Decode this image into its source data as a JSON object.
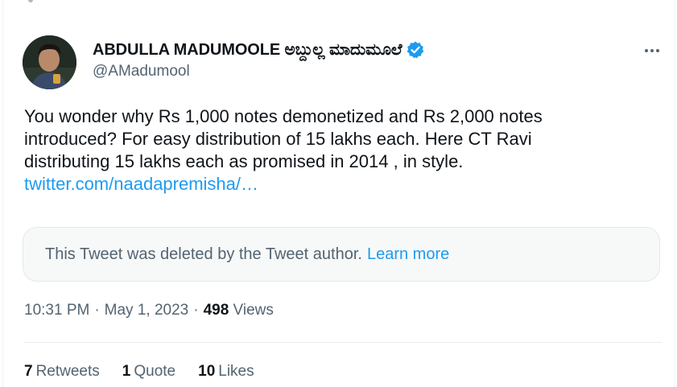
{
  "tweet": {
    "author": {
      "display_name": "ABDULLA MADUMOOLE ಅಬ್ದುಲ್ಲ ಮಾದುಮೂಲೆ",
      "handle": "@AMadumool",
      "verified_icon": "verified-badge-icon",
      "verified_color": "#1d9bf0"
    },
    "more_icon": "more-options-icon",
    "text": {
      "line1": "You wonder why Rs 1,000 notes demonetized and Rs 2,000 notes",
      "line2": "introduced? For easy distribution of 15 lakhs each. Here CT Ravi",
      "line3": "distributing 15 lakhs each as promised in 2014 , in style.",
      "link": "twitter.com/naadapremisha/…"
    },
    "quoted": {
      "message": "This Tweet was deleted by the Tweet author.",
      "learn_more": "Learn more"
    },
    "meta": {
      "time": "10:31 PM",
      "separator": "·",
      "date": "May 1, 2023",
      "views_count": "498",
      "views_label": "Views"
    },
    "stats": [
      {
        "count": "7",
        "label": "Retweets"
      },
      {
        "count": "1",
        "label": "Quote"
      },
      {
        "count": "10",
        "label": "Likes"
      }
    ]
  },
  "colors": {
    "accent": "#1d9bf0",
    "text_primary": "#0f1419",
    "text_secondary": "#536471",
    "border": "#e8ecee"
  }
}
